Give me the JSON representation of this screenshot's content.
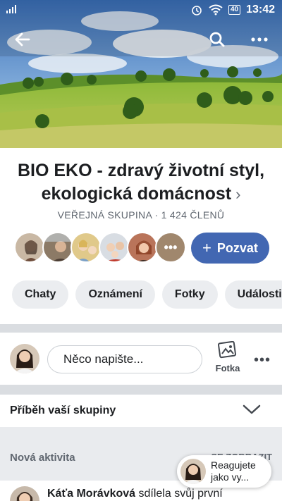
{
  "status_bar": {
    "time": "13:42",
    "battery": "40"
  },
  "header": {
    "back_icon": "arrow-left-icon",
    "search_icon": "search-icon",
    "more_icon": "more-horizontal-icon"
  },
  "group": {
    "title": "BIO EKO - zdravý životní styl, ekologická domácnost",
    "chevron": "›",
    "meta": "VEŘEJNÁ SKUPINA · 1 424 ČLENŮ"
  },
  "members": {
    "more_glyph": "•••",
    "invite_label": "Pozvat",
    "invite_plus": "+"
  },
  "tabs": [
    {
      "label": "Chaty"
    },
    {
      "label": "Oznámení"
    },
    {
      "label": "Fotky"
    },
    {
      "label": "Události"
    }
  ],
  "composer": {
    "placeholder": "Něco napište...",
    "photo_label": "Fotka",
    "more_glyph": "•••"
  },
  "story": {
    "label": "Příběh vaší skupiny"
  },
  "activity": {
    "label": "Nová aktivita",
    "see_all": "SE ZOBRAZIT"
  },
  "post": {
    "author": "Káťa Morávková",
    "action": " sdílela svůj první"
  },
  "react_as": {
    "text": "Reagujete jako vy..."
  },
  "colors": {
    "accent": "#4267b2",
    "pill_bg": "#ebedf0",
    "divider": "#dadde1"
  }
}
